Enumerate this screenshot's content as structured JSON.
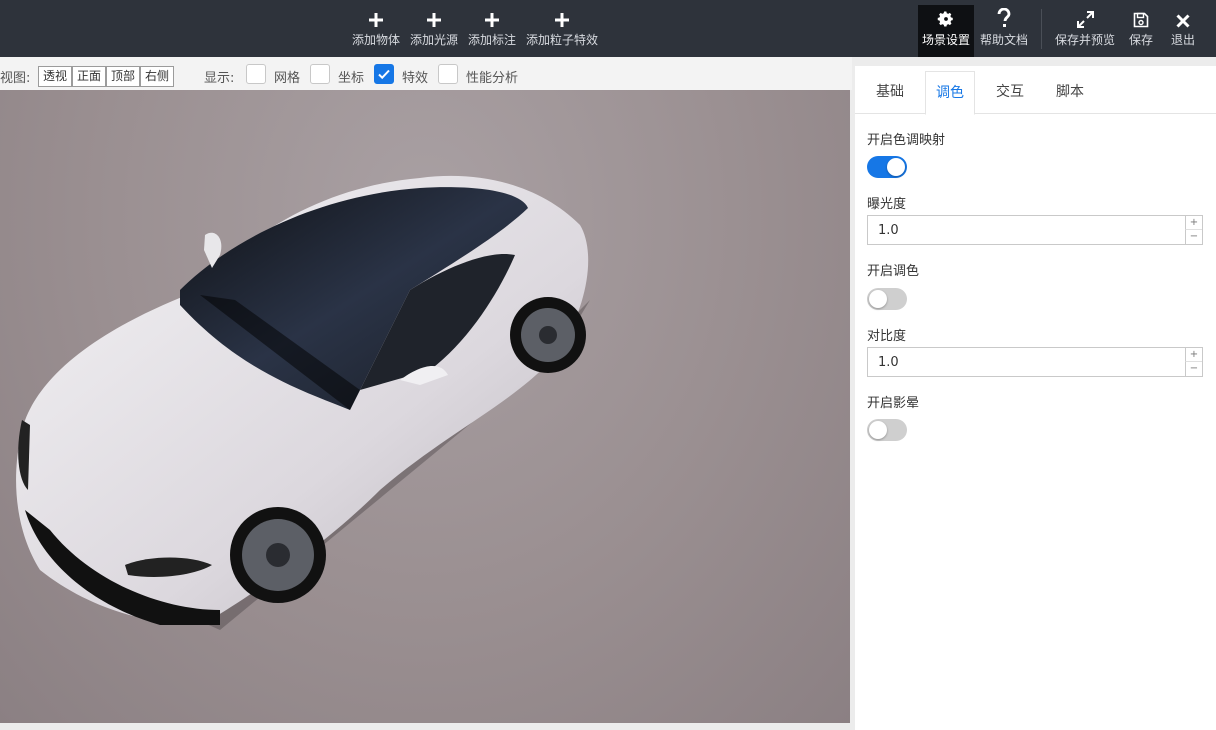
{
  "toolbar": {
    "add_object": "添加物体",
    "add_light": "添加光源",
    "add_annotation": "添加标注",
    "add_particle": "添加粒子特效",
    "scene_settings": "场景设置",
    "help_docs": "帮助文档",
    "save_preview": "保存并预览",
    "save": "保存",
    "exit": "退出"
  },
  "viewbar": {
    "view_label": "视图:",
    "views": [
      "透视",
      "正面",
      "顶部",
      "右侧"
    ],
    "display_label": "显示:",
    "options": [
      {
        "label": "网格",
        "checked": false
      },
      {
        "label": "坐标",
        "checked": false
      },
      {
        "label": "特效",
        "checked": true
      },
      {
        "label": "性能分析",
        "checked": false
      }
    ]
  },
  "panel": {
    "tabs": [
      "基础",
      "调色",
      "交互",
      "脚本"
    ],
    "active_tab": "调色",
    "tone_mapping": {
      "label": "开启色调映射",
      "on": true
    },
    "exposure": {
      "label": "曝光度",
      "value": "1.0"
    },
    "color_grading": {
      "label": "开启调色",
      "on": false
    },
    "contrast": {
      "label": "对比度",
      "value": "1.0"
    },
    "vignette": {
      "label": "开启影晕",
      "on": false
    },
    "stepper_up": "+",
    "stepper_down": "−"
  },
  "colors": {
    "toolbar_bg": "#2e333b",
    "accent": "#1677e6",
    "viewport_bg": "#9a8f91"
  }
}
